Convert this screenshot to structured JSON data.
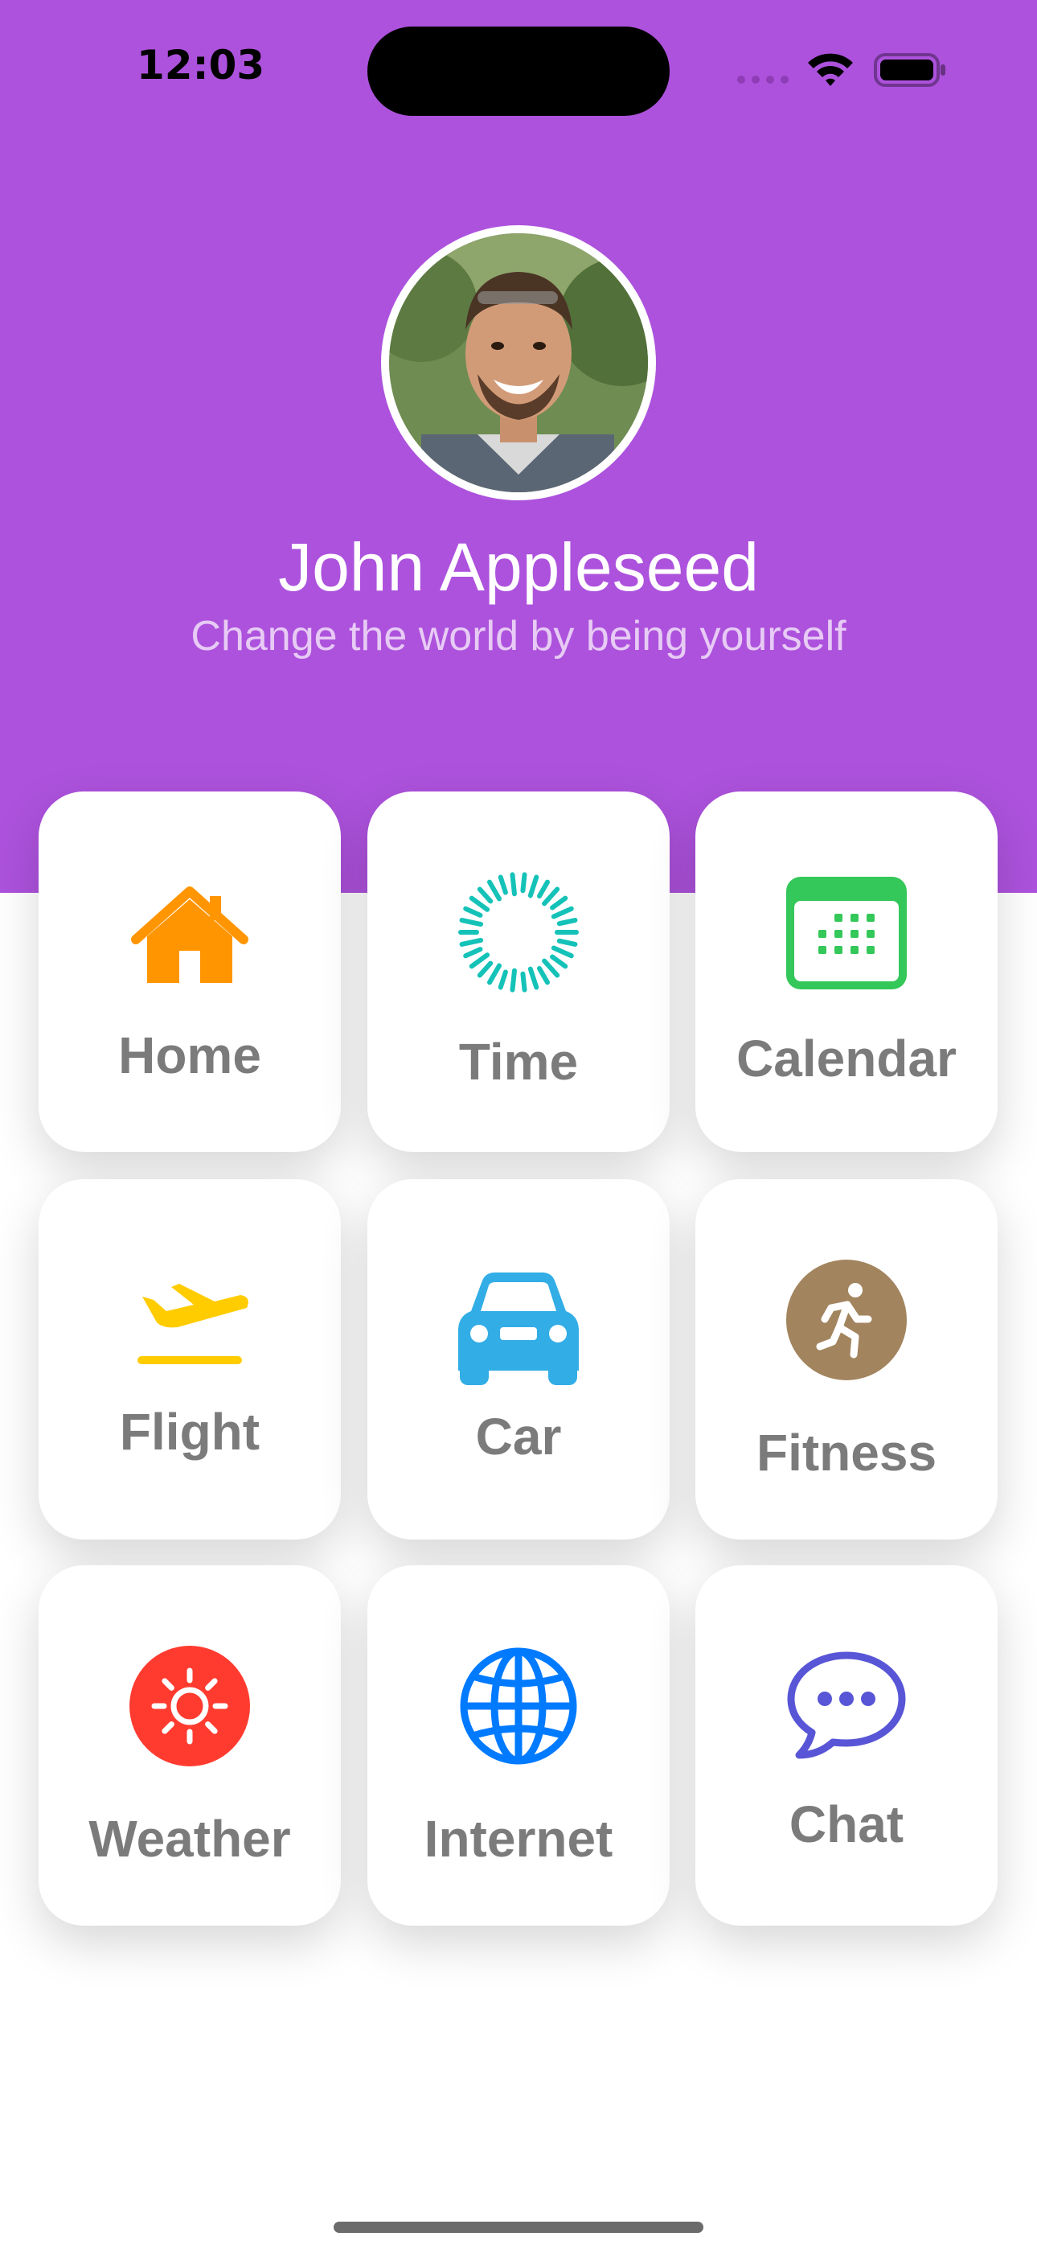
{
  "status_bar": {
    "time": "12:03"
  },
  "colors": {
    "header_background": "#ad52dd",
    "tile_label": "#7b7b7b",
    "home_icon": "#ff9500",
    "time_icon": "#14c2b8",
    "calendar_icon": "#34c759",
    "flight_icon": "#ffcc00",
    "car_icon": "#32ade6",
    "fitness_icon": "#a2845e",
    "weather_icon": "#ff3b30",
    "internet_icon": "#007aff",
    "chat_icon": "#5856d6"
  },
  "profile": {
    "name": "John Appleseed",
    "bio": "Change the world by being yourself"
  },
  "tiles": [
    {
      "label": "Home",
      "icon": "house-icon"
    },
    {
      "label": "Time",
      "icon": "timer-icon"
    },
    {
      "label": "Calendar",
      "icon": "calendar-icon"
    },
    {
      "label": "Flight",
      "icon": "airplane-icon"
    },
    {
      "label": "Car",
      "icon": "car-icon"
    },
    {
      "label": "Fitness",
      "icon": "figure-run-icon"
    },
    {
      "label": "Weather",
      "icon": "sun-icon"
    },
    {
      "label": "Internet",
      "icon": "globe-icon"
    },
    {
      "label": "Chat",
      "icon": "chat-bubble-icon"
    }
  ]
}
